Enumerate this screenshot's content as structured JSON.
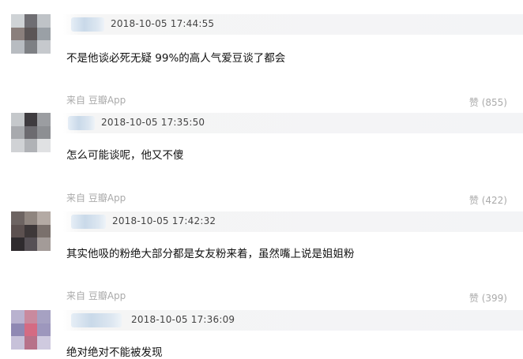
{
  "comments": [
    {
      "timestamp": "2018-10-05 17:44:55",
      "text": "不是他谈必死无疑 99%的高人气爱豆谈了都会",
      "source": "来自 豆瓣App",
      "likes": "赞 (855)"
    },
    {
      "timestamp": "2018-10-05 17:35:50",
      "text": "怎么可能谈呢，他又不傻",
      "source": "来自 豆瓣App",
      "likes": "赞 (422)"
    },
    {
      "timestamp": "2018-10-05 17:42:32",
      "text": "其实他吸的粉绝大部分都是女友粉来着，虽然嘴上说是姐姐粉",
      "source": "来自 豆瓣App",
      "likes": "赞 (399)"
    },
    {
      "timestamp": "2018-10-05 17:36:09",
      "text": "绝对绝对不能被发现"
    }
  ]
}
